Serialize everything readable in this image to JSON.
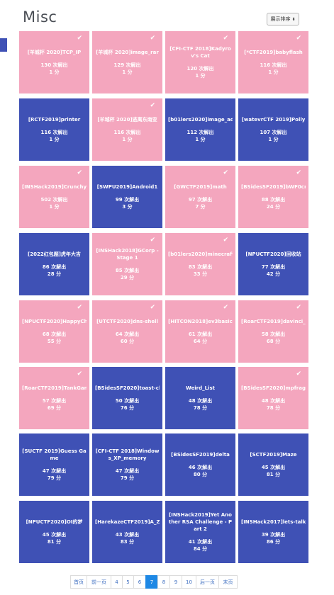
{
  "page": {
    "title": "Misc",
    "sort_label": "展示排序",
    "sort_caret": "⬍"
  },
  "cards": [
    {
      "name": "[羊城杯 2020]TCP_IP",
      "solves": "130 次解出",
      "score": "1 分",
      "color": "pink",
      "solved": true
    },
    {
      "name": "[羊城杯 2020]image_rar",
      "solves": "129 次解出",
      "score": "1 分",
      "color": "pink",
      "solved": true
    },
    {
      "name": "[CFI-CTF 2018]Kadyrov's Cat",
      "solves": "120 次解出",
      "score": "1 分",
      "color": "pink",
      "solved": true
    },
    {
      "name": "[*CTF2019]babyflash",
      "solves": "116 次解出",
      "score": "1 分",
      "color": "pink",
      "solved": true
    },
    {
      "name": "[RCTF2019]printer",
      "solves": "116 次解出",
      "score": "1 分",
      "color": "blue",
      "solved": false
    },
    {
      "name": "[羊城杯 2020]逃离东南亚",
      "solves": "116 次解出",
      "score": "1 分",
      "color": "pink",
      "solved": true
    },
    {
      "name": "[b01lers2020]image_adjustments",
      "solves": "112 次解出",
      "score": "1 分",
      "color": "blue",
      "solved": false
    },
    {
      "name": "[watevrCTF 2019]Polly",
      "solves": "107 次解出",
      "score": "1 分",
      "color": "blue",
      "solved": false
    },
    {
      "name": "[INSHack2019]Crunchy",
      "solves": "502 次解出",
      "score": "1 分",
      "color": "pink",
      "solved": true
    },
    {
      "name": "[SWPU2019]Android1",
      "solves": "99 次解出",
      "score": "3 分",
      "color": "blue",
      "solved": false
    },
    {
      "name": "[GWCTF2019]math",
      "solves": "97 次解出",
      "score": "7 分",
      "color": "pink",
      "solved": true
    },
    {
      "name": "[BSidesSF2019]bWF0cnlvc2hrYQ",
      "solves": "88 次解出",
      "score": "24 分",
      "color": "pink",
      "solved": true
    },
    {
      "name": "[2022红包题]虎年大吉",
      "solves": "86 次解出",
      "score": "28 分",
      "color": "blue",
      "solved": false
    },
    {
      "name": "[INSHack2018]GCorp - Stage 1",
      "solves": "85 次解出",
      "score": "29 分",
      "color": "pink",
      "solved": true
    },
    {
      "name": "[b01lers2020]minecraft_purdue",
      "solves": "83 次解出",
      "score": "33 分",
      "color": "pink",
      "solved": true
    },
    {
      "name": "[NPUCTF2020]回收站",
      "solves": "77 次解出",
      "score": "42 分",
      "color": "blue",
      "solved": false
    },
    {
      "name": "[NPUCTF2020]HappyCheckInVerification",
      "solves": "68 次解出",
      "score": "55 分",
      "color": "pink",
      "solved": true
    },
    {
      "name": "[UTCTF2020]dns-shell",
      "solves": "64 次解出",
      "score": "60 分",
      "color": "pink",
      "solved": true
    },
    {
      "name": "[HITCON2018]ev3basic",
      "solves": "61 次解出",
      "score": "64 分",
      "color": "pink",
      "solved": true
    },
    {
      "name": "[RoarCTF2019]davinci_cipher",
      "solves": "58 次解出",
      "score": "68 分",
      "color": "pink",
      "solved": true
    },
    {
      "name": "[RoarCTF2019]TankGame",
      "solves": "57 次解出",
      "score": "69 分",
      "color": "pink",
      "solved": true
    },
    {
      "name": "[BSidesSF2020]toast-clicker1",
      "solves": "50 次解出",
      "score": "76 分",
      "color": "blue",
      "solved": false
    },
    {
      "name": "Weird_List",
      "solves": "48 次解出",
      "score": "78 分",
      "color": "blue",
      "solved": false
    },
    {
      "name": "[BSidesSF2020]mpfrag",
      "solves": "48 次解出",
      "score": "78 分",
      "color": "pink",
      "solved": true
    },
    {
      "name": "[SUCTF 2019]Guess Game",
      "solves": "47 次解出",
      "score": "79 分",
      "color": "blue",
      "solved": false
    },
    {
      "name": "[CFI-CTF 2018]Windows_XP_memory",
      "solves": "47 次解出",
      "score": "79 分",
      "color": "blue",
      "solved": false
    },
    {
      "name": "[BSidesSF2019]delta",
      "solves": "46 次解出",
      "score": "80 分",
      "color": "blue",
      "solved": false
    },
    {
      "name": "[SCTF2019]Maze",
      "solves": "45 次解出",
      "score": "81 分",
      "color": "blue",
      "solved": false
    },
    {
      "name": "[NPUCTF2020]OI的梦",
      "solves": "45 次解出",
      "score": "81 分",
      "color": "blue",
      "solved": false
    },
    {
      "name": "[HarekazeCTF2019]A_Z",
      "solves": "43 次解出",
      "score": "83 分",
      "color": "blue",
      "solved": false
    },
    {
      "name": "[INSHack2019]Yet Another RSA Challenge - Part 2",
      "solves": "41 次解出",
      "score": "84 分",
      "color": "blue",
      "solved": false
    },
    {
      "name": "[INSHack2017]lets-talk",
      "solves": "39 次解出",
      "score": "86 分",
      "color": "blue",
      "solved": false
    }
  ],
  "pagination": [
    {
      "label": "首页",
      "active": false
    },
    {
      "label": "前一页",
      "active": false
    },
    {
      "label": "4",
      "active": false
    },
    {
      "label": "5",
      "active": false
    },
    {
      "label": "6",
      "active": false
    },
    {
      "label": "7",
      "active": true
    },
    {
      "label": "8",
      "active": false
    },
    {
      "label": "9",
      "active": false
    },
    {
      "label": "10",
      "active": false
    },
    {
      "label": "后一页",
      "active": false
    },
    {
      "label": "末页",
      "active": false
    }
  ],
  "colors": {
    "pink": "#f4a6be",
    "blue": "#3f51b5",
    "active_page": "#1e88e5"
  },
  "icons": {
    "solved": "check-icon",
    "sort": "sort-caret-icon"
  }
}
